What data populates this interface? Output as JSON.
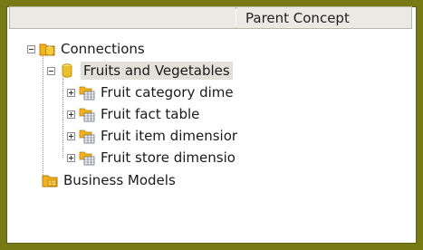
{
  "header": {
    "col_name": "",
    "col_parent": "Parent Concept"
  },
  "tree": {
    "connections": "Connections",
    "fruits_and_vegetables": "Fruits and Vegetables",
    "children": [
      "Fruit category dime",
      "Fruit fact table",
      "Fruit item dimensior",
      "Fruit store dimensio"
    ],
    "business_models": "Business Models"
  },
  "icons": {
    "connections": "database-folder-icon",
    "fruits_and_vegetables": "database-icon",
    "table": "table-icon",
    "business_models": "business-model-folder-icon"
  },
  "colors": {
    "frame": "#777a14",
    "selection": "#e2e0da",
    "folder": "#f2b21b",
    "db": "#e8c12a"
  }
}
